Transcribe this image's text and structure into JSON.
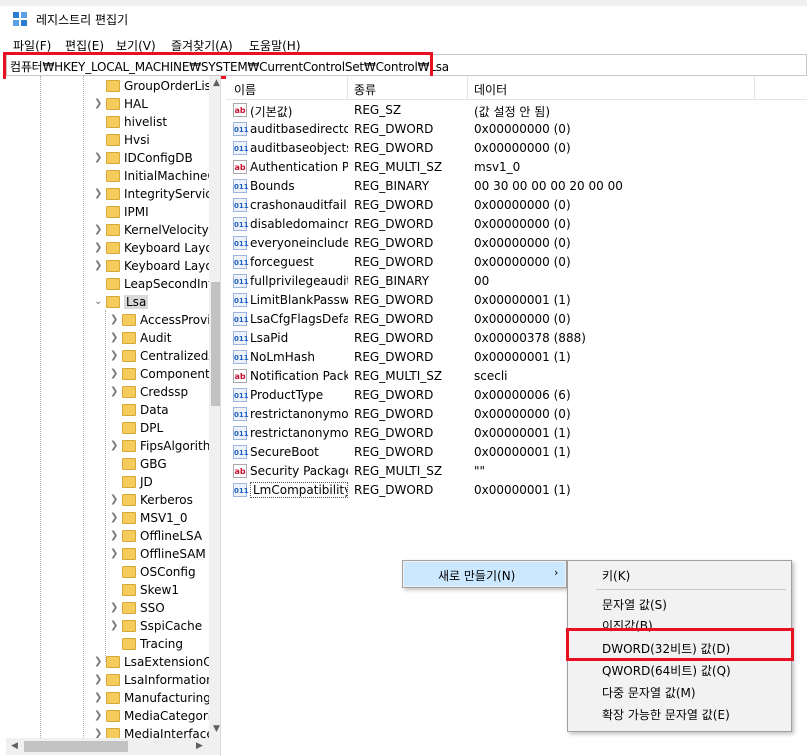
{
  "window": {
    "title": "레지스트리 편집기"
  },
  "menu": [
    "파일(F)",
    "편집(E)",
    "보기(V)",
    "즐겨찾기(A)",
    "도움말(H)"
  ],
  "address": "컴퓨터₩HKEY_LOCAL_MACHINE₩SYSTEM₩CurrentControlSet₩Control₩Lsa",
  "tree": {
    "items": [
      "GroupOrderList",
      "HAL",
      "hivelist",
      "Hvsi",
      "IDConfigDB",
      "InitialMachineConfig",
      "IntegrityServices",
      "IPMI",
      "KernelVelocity",
      "Keyboard Layout",
      "Keyboard Layouts",
      "LeapSecondInformation",
      "Lsa",
      "AccessProviders",
      "Audit",
      "CentralizedAccessPolicies",
      "ComponentUpdates",
      "Credssp",
      "Data",
      "DPL",
      "FipsAlgorithmPolicy",
      "GBG",
      "JD",
      "Kerberos",
      "MSV1_0",
      "OfflineLSA",
      "OfflineSAM",
      "OSConfig",
      "Skew1",
      "SSO",
      "SspiCache",
      "Tracing",
      "LsaExtensionConfig",
      "LsaInformation",
      "ManufacturingMode",
      "MediaCategories",
      "MediaInterfaces"
    ]
  },
  "list": {
    "columns": [
      "이름",
      "종류",
      "데이터"
    ],
    "rows": [
      {
        "icon": "ab",
        "name": "(기본값)",
        "type": "REG_SZ",
        "data": "(값 설정 안 됨)"
      },
      {
        "icon": "bin",
        "name": "auditbasedirectories",
        "type": "REG_DWORD",
        "data": "0x00000000 (0)"
      },
      {
        "icon": "bin",
        "name": "auditbaseobjects",
        "type": "REG_DWORD",
        "data": "0x00000000 (0)"
      },
      {
        "icon": "ab",
        "name": "Authentication Packages",
        "type": "REG_MULTI_SZ",
        "data": "msv1_0"
      },
      {
        "icon": "bin",
        "name": "Bounds",
        "type": "REG_BINARY",
        "data": "00 30 00 00 00 20 00 00"
      },
      {
        "icon": "bin",
        "name": "crashonauditfail",
        "type": "REG_DWORD",
        "data": "0x00000000 (0)"
      },
      {
        "icon": "bin",
        "name": "disabledomaincreds",
        "type": "REG_DWORD",
        "data": "0x00000000 (0)"
      },
      {
        "icon": "bin",
        "name": "everyoneincludesanonymous",
        "type": "REG_DWORD",
        "data": "0x00000000 (0)"
      },
      {
        "icon": "bin",
        "name": "forceguest",
        "type": "REG_DWORD",
        "data": "0x00000000 (0)"
      },
      {
        "icon": "bin",
        "name": "fullprivilegeauditing",
        "type": "REG_BINARY",
        "data": "00"
      },
      {
        "icon": "bin",
        "name": "LimitBlankPasswordUse",
        "type": "REG_DWORD",
        "data": "0x00000001 (1)"
      },
      {
        "icon": "bin",
        "name": "LsaCfgFlagsDefault",
        "type": "REG_DWORD",
        "data": "0x00000000 (0)"
      },
      {
        "icon": "bin",
        "name": "LsaPid",
        "type": "REG_DWORD",
        "data": "0x00000378 (888)"
      },
      {
        "icon": "bin",
        "name": "NoLmHash",
        "type": "REG_DWORD",
        "data": "0x00000001 (1)"
      },
      {
        "icon": "ab",
        "name": "Notification Packages",
        "type": "REG_MULTI_SZ",
        "data": "scecli"
      },
      {
        "icon": "bin",
        "name": "ProductType",
        "type": "REG_DWORD",
        "data": "0x00000006 (6)"
      },
      {
        "icon": "bin",
        "name": "restrictanonymous",
        "type": "REG_DWORD",
        "data": "0x00000000 (0)"
      },
      {
        "icon": "bin",
        "name": "restrictanonymoussam",
        "type": "REG_DWORD",
        "data": "0x00000001 (1)"
      },
      {
        "icon": "bin",
        "name": "SecureBoot",
        "type": "REG_DWORD",
        "data": "0x00000001 (1)"
      },
      {
        "icon": "ab",
        "name": "Security Packages",
        "type": "REG_MULTI_SZ",
        "data": "\"\""
      },
      {
        "icon": "bin",
        "name": "LmCompatibilityLevel",
        "type": "REG_DWORD",
        "data": "0x00000001 (1)"
      }
    ]
  },
  "context_menu": {
    "new_label": "새로 만들기(N)",
    "submenu": {
      "key": "키(K)",
      "string": "문자열 값(S)",
      "binary": "이진값(B)",
      "dword": "DWORD(32비트) 값(D)",
      "qword": "QWORD(64비트) 값(Q)",
      "multi": "다중 문자열 값(M)",
      "expand": "확장 가능한 문자열 값(E)"
    }
  }
}
